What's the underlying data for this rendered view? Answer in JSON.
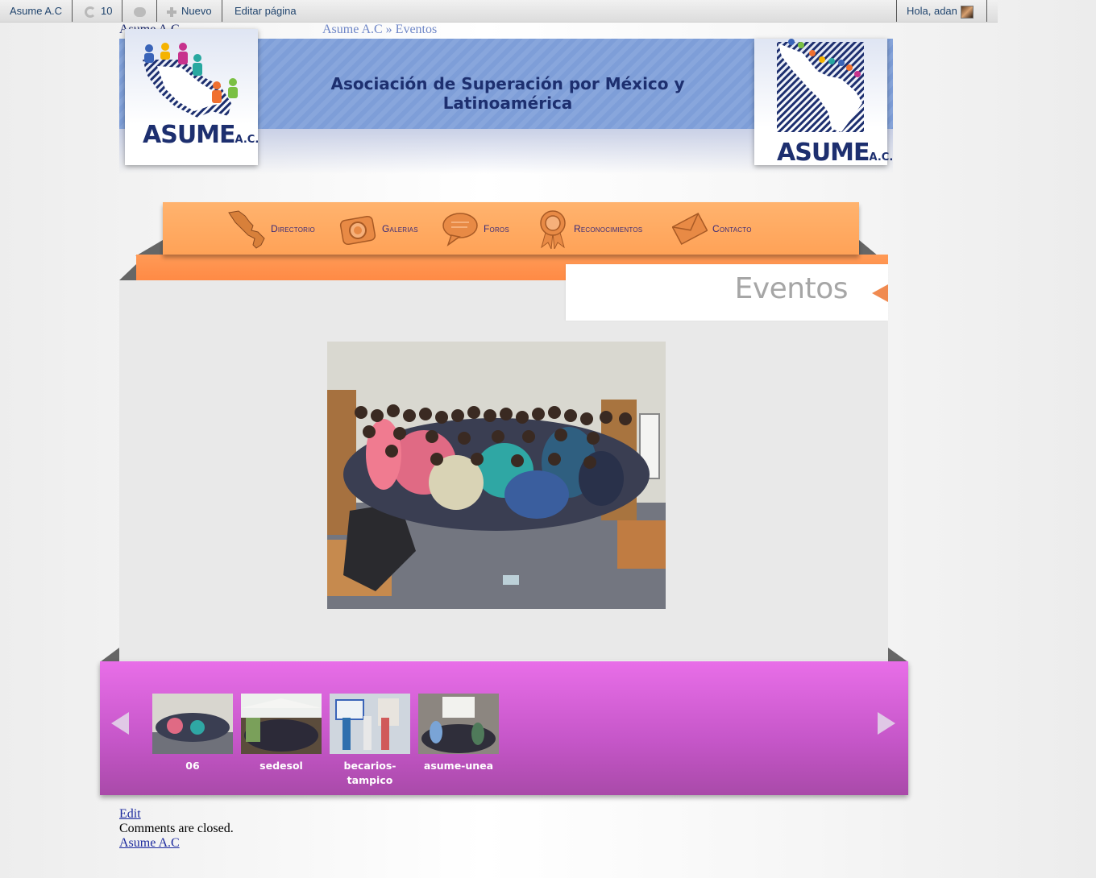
{
  "admin_bar": {
    "site_name": "Asume A.C",
    "updates_count": "10",
    "new_label": "Nuevo",
    "edit_label": "Editar página",
    "greeting": "Hola, adan"
  },
  "site": {
    "title": "Asume A.C",
    "breadcrumb": "Asume A.C » Eventos",
    "tagline": "Asociación de Superación por México y Latinoamérica",
    "logo_word": "ASUME",
    "logo_suffix": "A.C."
  },
  "nav": {
    "items": [
      {
        "label": "Directorio",
        "icon": "map-icon"
      },
      {
        "label": "Galerias",
        "icon": "camera-icon"
      },
      {
        "label": "Foros",
        "icon": "speech-bubble-icon"
      },
      {
        "label": "Reconocimientos",
        "icon": "award-ribbon-icon"
      },
      {
        "label": "Contacto",
        "icon": "envelope-icon"
      }
    ]
  },
  "page": {
    "title": "Eventos"
  },
  "gallery": {
    "thumbnails": [
      {
        "caption": "06"
      },
      {
        "caption": "sedesol"
      },
      {
        "caption": "becarios-tampico"
      },
      {
        "caption": "asume-unea"
      }
    ]
  },
  "footer": {
    "edit_link": "Edit",
    "comments_closed": "Comments are closed.",
    "site_link": "Asume A.C"
  },
  "colors": {
    "nav_orange": "#ffa257",
    "gallery_magenta": "#d65fd8",
    "header_blue": "#7e9ed8",
    "title_navy": "#1d2f6f"
  }
}
